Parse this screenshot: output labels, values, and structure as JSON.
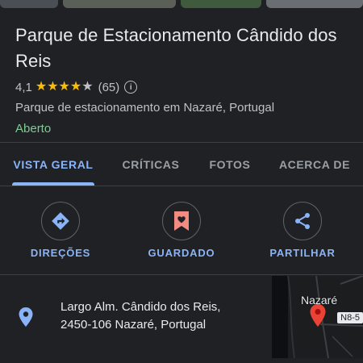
{
  "place": {
    "title": "Parque de Estacionamento Cândido dos Reis",
    "rating": "4,1",
    "stars_filled": 4,
    "stars_total": 5,
    "review_count": "(65)",
    "category": "Parque de estacionamento em Nazaré, Portugal",
    "status": "Aberto"
  },
  "tabs": [
    {
      "label": "VISTA GERAL",
      "active": true
    },
    {
      "label": "CRÍTICAS",
      "active": false
    },
    {
      "label": "FOTOS",
      "active": false
    },
    {
      "label": "ACERCA DE",
      "active": false
    }
  ],
  "actions": [
    {
      "label": "DIREÇÕES",
      "icon": "directions-icon"
    },
    {
      "label": "GUARDADO",
      "icon": "bookmark-icon"
    },
    {
      "label": "PARTILHAR",
      "icon": "share-icon"
    }
  ],
  "address": {
    "line1": "Largo Alm. Cândido dos Reis,",
    "line2": "2450-106 Nazaré, Portugal"
  },
  "map": {
    "town_label": "Nazaré",
    "road_badge": "N8-5"
  },
  "colors": {
    "background": "#202124",
    "accent": "#8ab4f8",
    "star": "#fbbc04",
    "open_status": "#81c995",
    "saved_red": "#f28b82"
  }
}
